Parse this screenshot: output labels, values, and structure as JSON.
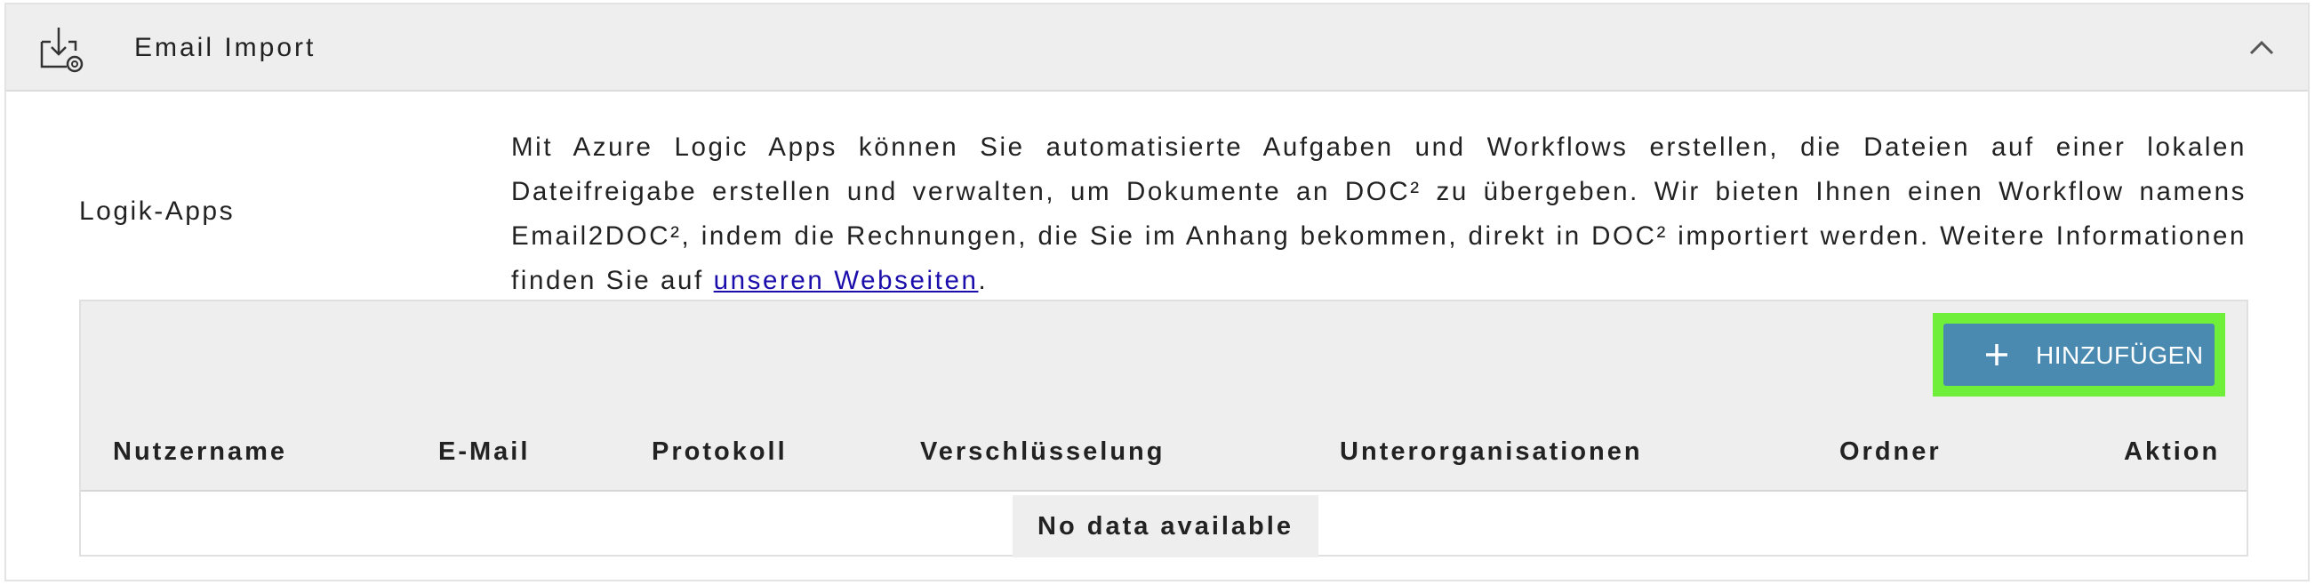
{
  "panel": {
    "title": "Email Import",
    "icon": "email-import-icon",
    "collapse_icon": "chevron-up-icon"
  },
  "section": {
    "label": "Logik-Apps",
    "description_before_link": "Mit Azure Logic Apps können Sie automatisierte Aufgaben und Workflows erstellen, die Dateien auf einer lokalen Dateifreigabe erstellen und verwalten, um Dokumente an DOC² zu übergeben. Wir bieten Ihnen einen Workflow namens Email2DOC², indem die Rechnungen, die Sie im Anhang bekommen, direkt in DOC² importiert werden. Weitere Informationen finden Sie auf ",
    "link_text": "unseren Webseiten",
    "description_after_link": "."
  },
  "table": {
    "add_button_label": "HINZUFÜGEN",
    "add_icon": "plus-icon",
    "columns": [
      "Nutzername",
      "E-Mail",
      "Protokoll",
      "Verschlüsselung",
      "Unterorganisationen",
      "Ordner",
      "Aktion"
    ],
    "empty_text": "No data available"
  },
  "colors": {
    "header_bg": "#eeeeee",
    "button_bg": "#4a8ab0",
    "highlight": "#6fef3a",
    "link": "#1a0dab"
  }
}
